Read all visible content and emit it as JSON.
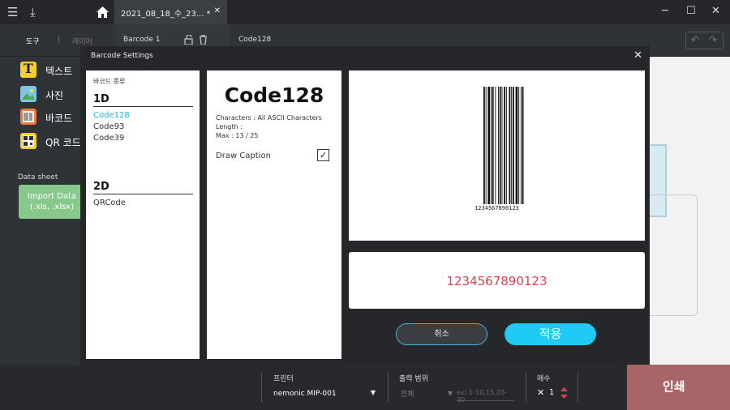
{
  "titlebar": {
    "doc_tab_title": "2021_08_18_수_23... *",
    "doc_tab_close": "✕",
    "win_min": "─",
    "win_max": "☐",
    "win_close": "✕"
  },
  "secondbar": {
    "tool_tab": "도구",
    "layer_tab": "레이어",
    "barcode_tab": "Barcode 1",
    "object_name": "Code128",
    "undo": "↶",
    "redo": "↷"
  },
  "leftpanel": {
    "tools": [
      {
        "label": "텍스트"
      },
      {
        "label": "사진"
      },
      {
        "label": "바코드"
      },
      {
        "label": "QR 코드"
      }
    ],
    "datasheet_label": "Data sheet",
    "import_line1": "Import Data",
    "import_line2": "(.xls, .xlsx)"
  },
  "dialog": {
    "title": "Barcode Settings",
    "close": "✕",
    "type_header": "바코드 종류",
    "section_1d": "1D",
    "types_1d": [
      "Code128",
      "Code93",
      "Code39"
    ],
    "section_2d": "2D",
    "types_2d": [
      "QRCode"
    ],
    "code_title": "Code128",
    "characters": "Characters : All ASCII Characters",
    "length": "Length :",
    "max": "Max : 13 / 25",
    "draw_caption": "Draw Caption",
    "checkmark": "✓",
    "barcode_caption": "1234567890123",
    "data_value": "1234567890123",
    "cancel": "취소",
    "apply": "적용"
  },
  "bottombar": {
    "printer_label": "프린터",
    "printer_value": "nemonic MIP-001",
    "range_label": "출력 범위",
    "range_value": "전체",
    "range_placeholder": "ex) 1-10,15,20-30",
    "copies_label": "매수",
    "copies_value": "1",
    "print_label": "인쇄"
  },
  "colors": {
    "accent": "#1fcbf5",
    "selected_type": "#19b4ea",
    "data_value": "#e0404a",
    "import_button": "#89c88d"
  }
}
